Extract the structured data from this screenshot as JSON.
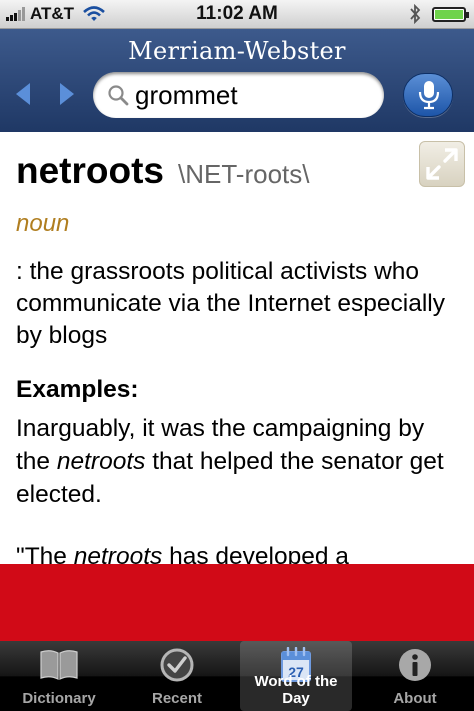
{
  "status_bar": {
    "carrier": "AT&T",
    "time": "11:02 AM"
  },
  "header": {
    "brand": "Merriam-Webster"
  },
  "search": {
    "value": "grommet"
  },
  "entry": {
    "headword": "netroots",
    "pronunciation": "\\NET-roots\\",
    "part_of_speech": "noun",
    "definition": ": the grassroots political activists who communicate via the Internet especially by blogs",
    "examples_label": "Examples:",
    "example1_pre": "Inarguably, it was the campaigning by the ",
    "example1_em": "netroots",
    "example1_post": " that helped the senator get elected.",
    "example2_pre": "\"The ",
    "example2_em": "netroots",
    "example2_post": " has developed a"
  },
  "tabs": [
    {
      "label": "Dictionary",
      "icon": "book-icon"
    },
    {
      "label": "Recent",
      "icon": "checkmark-clock-icon"
    },
    {
      "label": "Word of the Day",
      "icon": "calendar-icon",
      "calendar_day": "27",
      "active": true
    },
    {
      "label": "About",
      "icon": "info-icon"
    }
  ],
  "colors": {
    "header": "#2c4776",
    "pos": "#b07e20",
    "ad_band": "#d10a17",
    "mic": "#2e6cc3"
  }
}
